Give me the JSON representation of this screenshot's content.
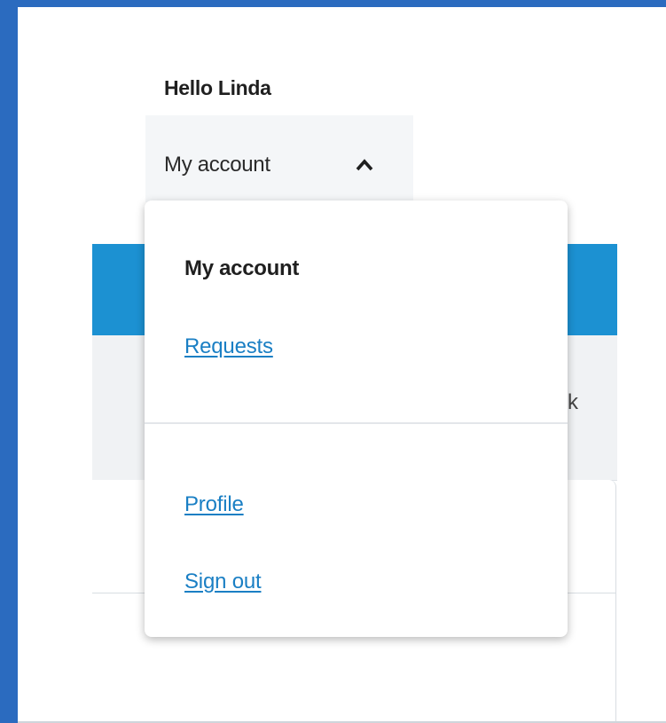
{
  "header": {
    "greeting": "Hello Linda",
    "account_menu_label": "My account",
    "account_menu_expanded": true
  },
  "background_content": {
    "partial_text": "k"
  },
  "account_dropdown": {
    "heading": "My account",
    "links": [
      {
        "label": "Requests"
      },
      {
        "label": "Profile"
      },
      {
        "label": "Sign out"
      }
    ]
  },
  "colors": {
    "outer_border": "#2b6bbf",
    "link": "#1a7fc4",
    "accent_band": "#1c91d2"
  },
  "icons": {
    "account_toggle": "chevron-up-icon"
  }
}
